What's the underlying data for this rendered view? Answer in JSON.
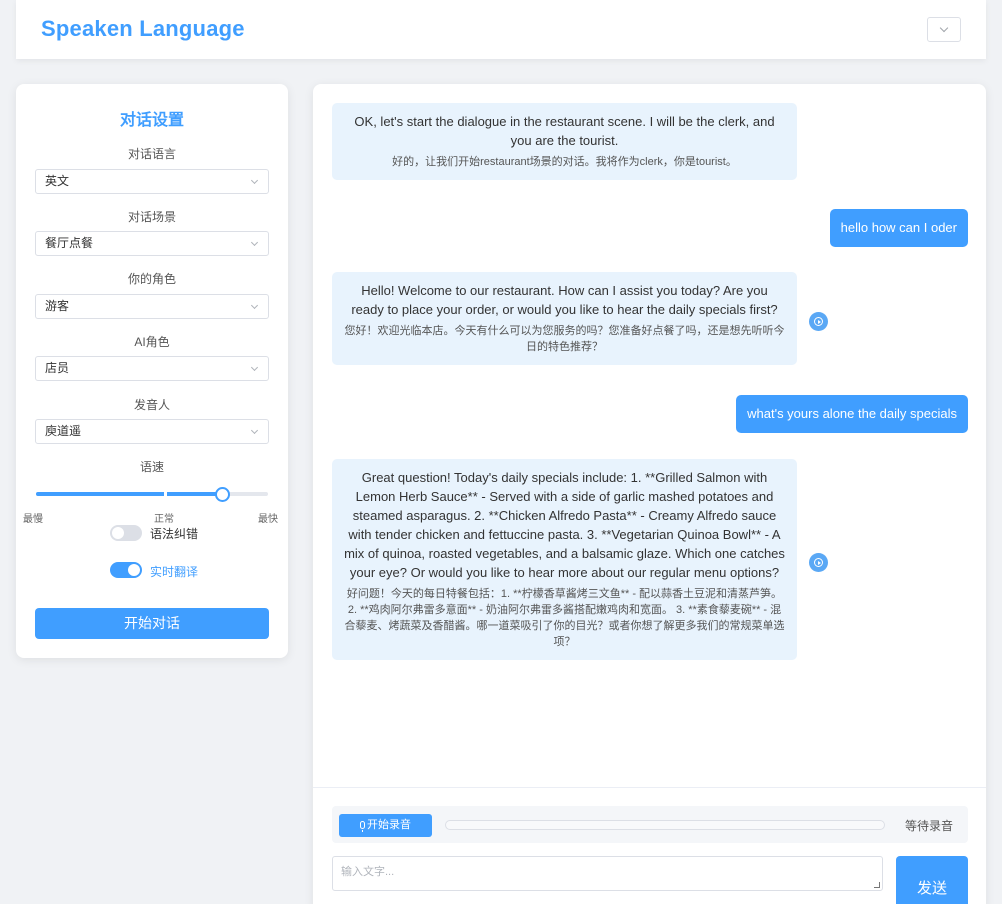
{
  "app": {
    "title": "Speaken Language"
  },
  "settings": {
    "title": "对话设置",
    "language": {
      "label": "对话语言",
      "value": "英文"
    },
    "scene": {
      "label": "对话场景",
      "value": "餐厅点餐"
    },
    "user_role": {
      "label": "你的角色",
      "value": "游客"
    },
    "ai_role": {
      "label": "AI角色",
      "value": "店员"
    },
    "speaker": {
      "label": "发音人",
      "value": "庾道遥"
    },
    "speed": {
      "label": "语速",
      "value": 0.8,
      "marks": {
        "slowest": "最慢",
        "normal": "正常",
        "fastest": "最快"
      }
    },
    "grammar_correction": {
      "label": "语法纠错",
      "enabled": false
    },
    "live_translation": {
      "label": "实时翻译",
      "enabled": true
    },
    "start_button": "开始对话"
  },
  "chat": {
    "messages": [
      {
        "role": "ai",
        "en": "OK, let's start the dialogue in the restaurant scene. I will be the clerk, and you are the tourist.",
        "zh": "好的，让我们开始restaurant场景的对话。我将作为clerk，你是tourist。"
      },
      {
        "role": "user",
        "text": "hello how can I oder"
      },
      {
        "role": "ai",
        "en": "Hello! Welcome to our restaurant. How can I assist you today? Are you ready to place your order, or would you like to hear the daily specials first?",
        "zh": "您好！欢迎光临本店。今天有什么可以为您服务的吗？您准备好点餐了吗，还是想先听听今日的特色推荐？"
      },
      {
        "role": "user",
        "text": "what's yours alone the daily specials"
      },
      {
        "role": "ai",
        "en": "Great question! Today's daily specials include: 1. **Grilled Salmon with Lemon Herb Sauce** - Served with a side of garlic mashed potatoes and steamed asparagus. 2. **Chicken Alfredo Pasta** - Creamy Alfredo sauce with tender chicken and fettuccine pasta. 3. **Vegetarian Quinoa Bowl** - A mix of quinoa, roasted vegetables, and a balsamic glaze. Which one catches your eye? Or would you like to hear more about our regular menu options?",
        "zh": "好问题！今天的每日特餐包括：1. **柠檬香草酱烤三文鱼** - 配以蒜香土豆泥和清蒸芦笋。 2. **鸡肉阿尔弗雷多意面** - 奶油阿尔弗雷多酱搭配嫩鸡肉和宽面。 3. **素食藜麦碗** - 混合藜麦、烤蔬菜及香醋酱。哪一道菜吸引了你的目光？或者你想了解更多我们的常规菜单选项？"
      }
    ]
  },
  "composer": {
    "record_button": "开始录音",
    "record_status": "等待录音",
    "record_progress": 0,
    "input_placeholder": "输入文字...",
    "input_value": "",
    "send_button": "发送"
  },
  "icons": {
    "menu": "chevron-down-icon",
    "select": "chevron-down-icon",
    "play": "play-circle-icon",
    "record": "microphone-icon"
  },
  "colors": {
    "primary": "#409eff",
    "ai_bubble": "#e8f3fd",
    "background": "#f0f2f5"
  }
}
